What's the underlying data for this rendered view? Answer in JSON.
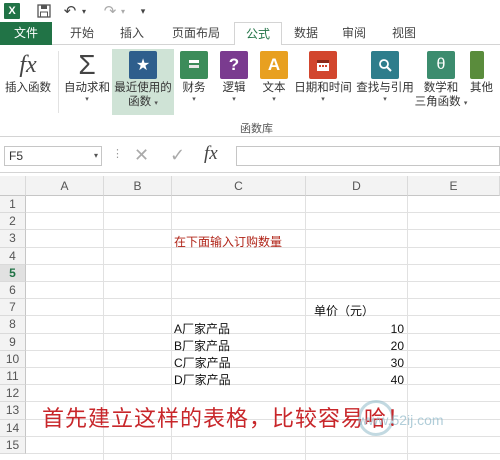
{
  "titlebar": {
    "logo": "X",
    "redo_drop": "▾",
    "undo_drop": "▾",
    "custom": "▾"
  },
  "tabs": {
    "file": "文件",
    "home": "开始",
    "insert": "插入",
    "layout": "页面布局",
    "formulas": "公式",
    "data": "数据",
    "review": "审阅",
    "view": "视图"
  },
  "ribbon": {
    "insert_fn": "插入函数",
    "autosum": "自动求和",
    "recent_1": "最近使用的",
    "recent_2": "函数",
    "finance": "财务",
    "logic": "逻辑",
    "text": "文本",
    "datetime": "日期和时间",
    "lookup": "查找与引用",
    "math_1": "数学和",
    "math_2": "三角函数",
    "other": "其他",
    "group_label": "函数库",
    "caret": "▾",
    "fx_glyph": "fx",
    "sigma_glyph": "Σ",
    "star_glyph": "★",
    "logic_glyph": "?",
    "text_glyph": "A",
    "math_glyph": "θ"
  },
  "formula_bar": {
    "name_box": "F5",
    "dropdown": "▾",
    "dots": "⋮",
    "cancel": "✕",
    "enter": "✓",
    "fx": "fx",
    "value": ""
  },
  "grid": {
    "columns": [
      "A",
      "B",
      "C",
      "D",
      "E"
    ],
    "rows": [
      "1",
      "2",
      "3",
      "4",
      "5",
      "6",
      "7",
      "8",
      "9",
      "10",
      "11",
      "12",
      "13",
      "14",
      "15"
    ],
    "selected_row": "5",
    "cells": {
      "c3": "在下面输入订购数量",
      "d7": "单价（元）",
      "c8": "A厂家产品",
      "d8": "10",
      "c9": "B厂家产品",
      "d9": "20",
      "c10": "C厂家产品",
      "d10": "30",
      "c11": "D厂家产品",
      "d11": "40"
    }
  },
  "caption": "首先建立这样的表格，比较容易哈！",
  "watermark": "www.52ij.com",
  "colors": {
    "excel_green": "#217346",
    "caption_red": "#c8262a",
    "recent_highlight": "#cfe3d6"
  }
}
